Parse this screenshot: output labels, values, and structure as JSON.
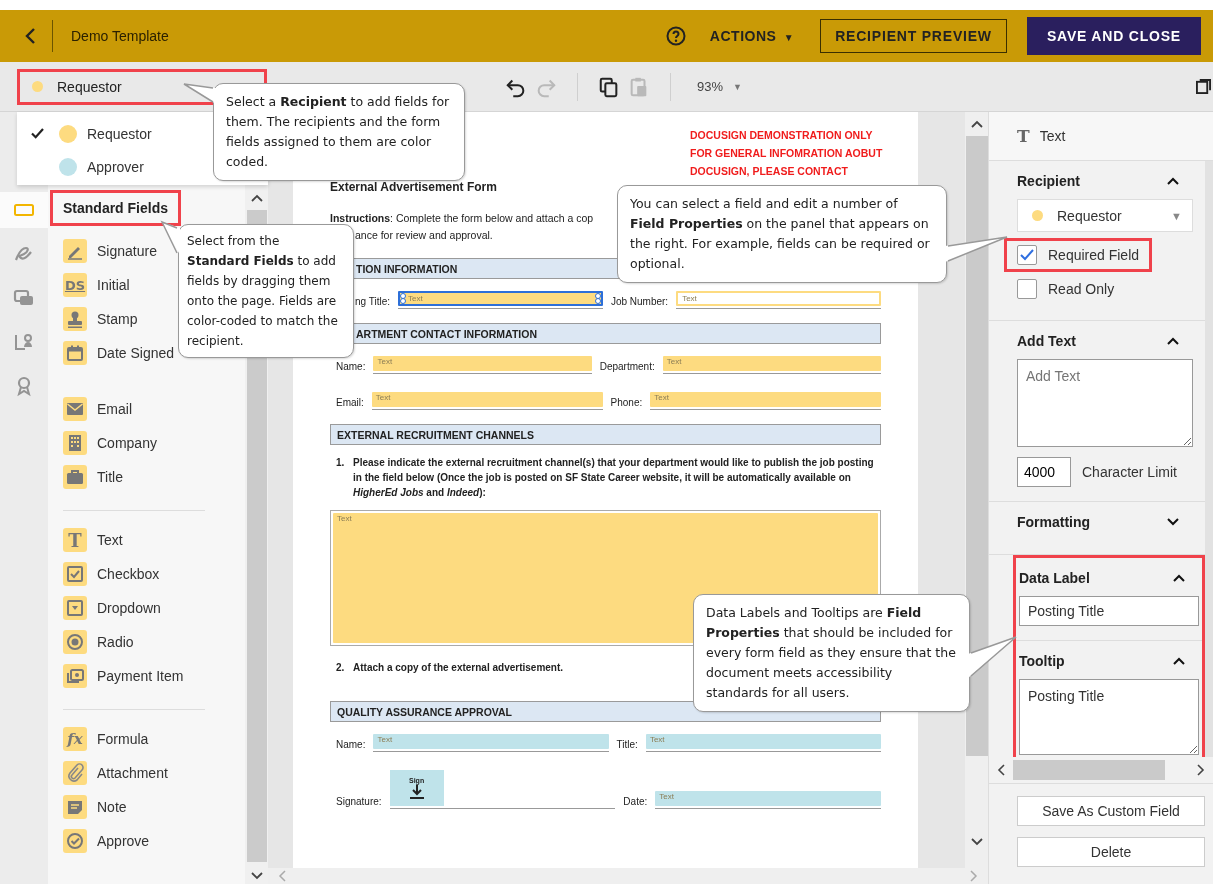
{
  "header": {
    "title": "Demo Template",
    "actions": "ACTIONS",
    "actions_caret": "▼",
    "preview_button": "RECIPIENT PREVIEW",
    "save_button": "SAVE AND CLOSE"
  },
  "toolbar": {
    "recipient": {
      "name": "Requestor",
      "color": "#fddb80",
      "highlighted": true
    },
    "tools": [
      {
        "kind": "undo",
        "disabled": false
      },
      {
        "kind": "redo",
        "disabled": true
      },
      {
        "kind": "copy",
        "disabled": false
      },
      {
        "kind": "paste",
        "disabled": true
      }
    ],
    "zoom": "93%",
    "zoom_caret": "▼"
  },
  "recipient_menu": [
    {
      "name": "Requestor",
      "color": "#fddb80",
      "selected": true
    },
    {
      "name": "Approver",
      "color": "#bfe3ea",
      "selected": false
    }
  ],
  "rail": [
    {
      "kind": "fields",
      "selected": true
    },
    {
      "kind": "signature",
      "selected": false
    },
    {
      "kind": "stack",
      "selected": false
    },
    {
      "kind": "person",
      "selected": false
    },
    {
      "kind": "award",
      "selected": false
    }
  ],
  "field_panel": {
    "heading": "Standard Fields",
    "highlighted": true,
    "groups": [
      [
        {
          "kind": "signature",
          "label": "Signature"
        },
        {
          "kind": "initial",
          "glyph": "DS",
          "label": "Initial"
        },
        {
          "kind": "stamp",
          "label": "Stamp"
        },
        {
          "kind": "date",
          "label": "Date Signed"
        },
        {
          "kind": "email",
          "label": "Email"
        },
        {
          "kind": "company",
          "label": "Company"
        },
        {
          "kind": "title",
          "label": "Title"
        }
      ],
      [
        {
          "kind": "text",
          "glyph": "T",
          "label": "Text"
        },
        {
          "kind": "checkbox",
          "label": "Checkbox"
        },
        {
          "kind": "dropdown",
          "label": "Dropdown"
        },
        {
          "kind": "radio",
          "label": "Radio"
        },
        {
          "kind": "payment",
          "label": "Payment Item"
        }
      ],
      [
        {
          "kind": "formula",
          "glyph": "fx",
          "label": "Formula"
        },
        {
          "kind": "attachment",
          "label": "Attachment"
        },
        {
          "kind": "note",
          "label": "Note"
        },
        {
          "kind": "approve",
          "label": "Approve"
        }
      ]
    ]
  },
  "document": {
    "notice": [
      "DOCUSIGN DEMONSTRATION ONLY",
      "FOR GENERAL INFOMRATION AOBUT",
      "DOCUSIGN, PLEASE CONTACT"
    ],
    "title": "External Advertisement Form",
    "instructions": [
      "**Instructions**: Complete the form below and attach a cop",
      "ance for review and approval."
    ],
    "sections": [
      {
        "heading": "TION INFORMATION",
        "rows": [
          [
            {
              "label": "ng Title:",
              "kind": "filled",
              "value": "Text",
              "color": "#fddb80",
              "selected": true
            },
            {
              "label": "Job Number:",
              "kind": "outline",
              "value": "Text",
              "color": "#fddb80",
              "selected": false
            }
          ]
        ]
      },
      {
        "heading": "ARTMENT CONTACT INFORMATION",
        "rows": [
          [
            {
              "label": "Name:",
              "kind": "filled",
              "value": "Text",
              "color": "#fddb80",
              "selected": false
            },
            {
              "label": "Department:",
              "kind": "filled",
              "value": "Text",
              "color": "#fddb80",
              "selected": false
            }
          ],
          [
            {
              "label": "Email:",
              "kind": "filled",
              "value": "Text",
              "color": "#fddb80",
              "selected": false
            },
            {
              "label": "Phone:",
              "kind": "filled",
              "value": "Text",
              "color": "#fddb80",
              "selected": false
            }
          ]
        ]
      },
      {
        "heading": "EXTERNAL RECRUITMENT CHANNELS",
        "items": [
          {
            "number": "1.",
            "text": "Please indicate the external recruitment channel(s) that your department would like to publish the job posting in the field below (Once the job is posted on SF State Career website, it will be automatically available on *HigherEd Jobs* and *Indeed*):",
            "field": {
              "kind": "area",
              "value": "Text",
              "color": "#fddb80",
              "selected": false
            }
          },
          {
            "number": "2.",
            "text": "Attach a copy of the external advertisement."
          }
        ]
      },
      {
        "heading": "QUALITY ASSURANCE APPROVAL",
        "rows": [
          [
            {
              "label": "Name:",
              "kind": "filled",
              "value": "Text",
              "color": "#bfe3ea",
              "selected": false
            },
            {
              "label": "Title:",
              "kind": "filled",
              "value": "Text",
              "color": "#bfe3ea",
              "selected": false
            }
          ],
          [
            {
              "label": "Signature:",
              "kind": "sign",
              "value": "Sign",
              "color": "#bfe3ea",
              "selected": false
            },
            {
              "label": "Date:",
              "kind": "filled",
              "value": "Text",
              "color": "#bfe3ea",
              "selected": false
            }
          ]
        ]
      }
    ]
  },
  "properties": {
    "field_type": {
      "glyph": "T",
      "label": "Text"
    },
    "recipient": {
      "heading": "Recipient",
      "expanded": true,
      "name": "Requestor",
      "color": "#fddb80",
      "caret": "▼",
      "options": [
        {
          "label": "Required Field",
          "checked": true,
          "highlighted": true
        },
        {
          "label": "Read Only",
          "checked": false,
          "highlighted": false
        }
      ]
    },
    "add_text": {
      "heading": "Add Text",
      "expanded": true,
      "placeholder": "Add Text",
      "limit": "4000",
      "limit_label": "Character Limit"
    },
    "formatting": {
      "heading": "Formatting",
      "expanded": false
    },
    "labels_highlighted": true,
    "data_label": {
      "heading": "Data Label",
      "expanded": true,
      "value": "Posting Title"
    },
    "tooltip": {
      "heading": "Tooltip",
      "expanded": true,
      "value": "Posting Title"
    },
    "buttons": [
      "Save As Custom Field",
      "Delete"
    ]
  },
  "callouts": [
    {
      "text": "Select a **Recipient** to add fields for them. The recipients and the form fields assigned to them are color coded."
    },
    {
      "text": "Select from the **Standard Fields** to add fields by dragging them onto the page. Fields are color-coded to match the recipient."
    },
    {
      "text": "You can select a field and edit  a number of **Field Properties** on the panel that appears on the right. For example, fields can be required or optional."
    },
    {
      "text": "Data Labels and Tooltips are **Field Properties** that should be included for every form field as they ensure that the document meets accessibility standards for all users."
    }
  ]
}
